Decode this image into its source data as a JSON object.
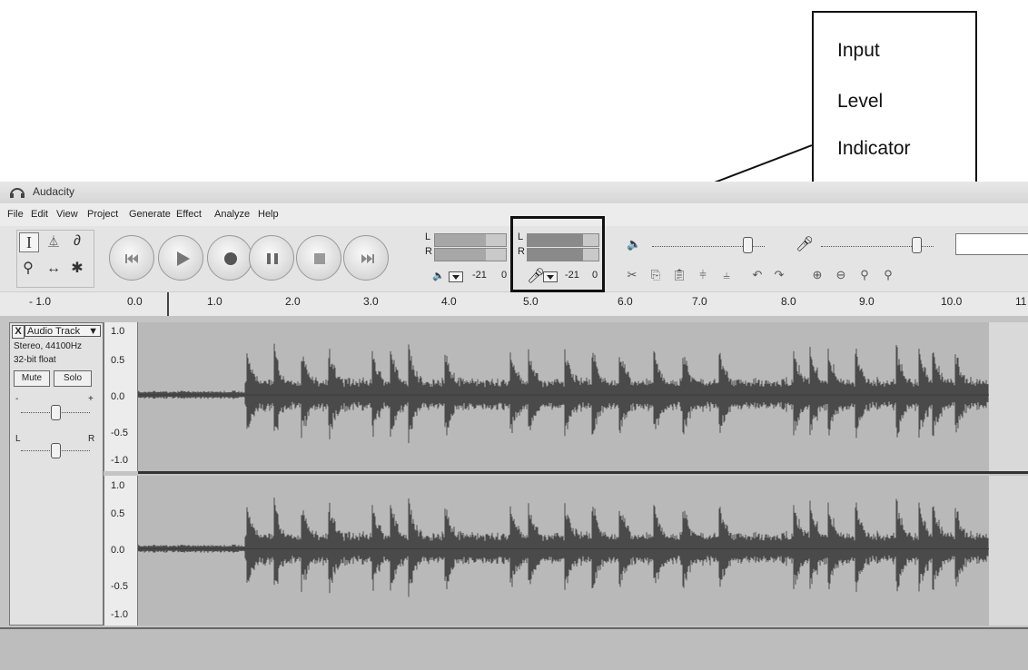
{
  "callout": {
    "lines": [
      "Input",
      "Level",
      "Indicator"
    ]
  },
  "window": {
    "title": "Audacity"
  },
  "menu": [
    "File",
    "Edit",
    "View",
    "Project",
    "Generate",
    "Effect",
    "Analyze",
    "Help"
  ],
  "tools": {
    "selection": "selection-tool",
    "envelope": "envelope-tool",
    "draw": "draw-tool",
    "zoom": "zoom-tool",
    "timeshift": "time-shift-tool",
    "multi": "multi-tool"
  },
  "transport": [
    "skip-start",
    "play",
    "record",
    "pause",
    "stop",
    "skip-end"
  ],
  "meters": {
    "playback": {
      "l": "L",
      "r": "R",
      "db": "-21",
      "zero": "0",
      "level_l": 0.72,
      "level_r": 0.72
    },
    "recording": {
      "l": "L",
      "r": "R",
      "db": "-21",
      "zero": "0",
      "level_l": 0.78,
      "level_r": 0.78
    }
  },
  "mixer": {
    "output_volume": 0.85,
    "input_volume": 0.85
  },
  "ruler": {
    "labels": [
      "- 1.0",
      "0.0",
      "1.0",
      "2.0",
      "3.0",
      "4.0",
      "5.0",
      "6.0",
      "7.0",
      "8.0",
      "9.0",
      "10.0",
      "11"
    ]
  },
  "track": {
    "close": "X",
    "name": "Audio Track",
    "info1": "Stereo, 44100Hz",
    "info2": "32-bit float",
    "mute": "Mute",
    "solo": "Solo",
    "gain_minus": "-",
    "gain_plus": "+",
    "pan_l": "L",
    "pan_r": "R",
    "gain": 0.5,
    "pan": 0.5
  },
  "vertical_ruler": {
    "channel1": [
      "1.0",
      "0.5",
      "0.0",
      "-0.5",
      "-1.0"
    ],
    "channel2": [
      "1.0",
      "0.5",
      "0.0",
      "-0.5",
      "-1.0"
    ]
  }
}
